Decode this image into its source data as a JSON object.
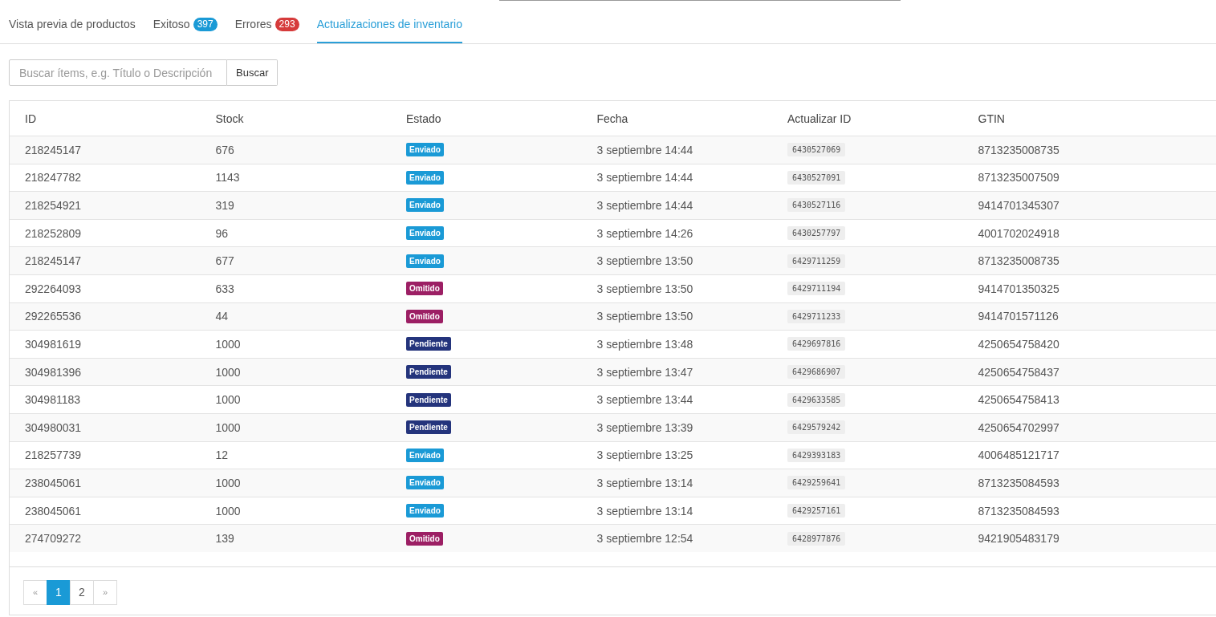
{
  "tabs": [
    {
      "label": "Vista previa de productos",
      "selected": false
    },
    {
      "label": "Exitoso",
      "count": {
        "text": "397",
        "color": "#1a9ad6"
      },
      "selected": false
    },
    {
      "label": "Errores",
      "count": {
        "text": "293",
        "color": "#d63b3b"
      },
      "selected": false
    },
    {
      "label": "Actualizaciones de inventario",
      "selected": true
    }
  ],
  "search": {
    "placeholder": "Buscar ítems, e.g. Título o Descripción",
    "button": "Buscar"
  },
  "table": {
    "columns": [
      "ID",
      "Stock",
      "Estado",
      "Fecha",
      "Actualizar ID",
      "GTIN"
    ],
    "rows": [
      {
        "id": "218245147",
        "stock": "676",
        "status": "Enviado",
        "color": "#1a9ad6",
        "date": "3 septiembre 14:44",
        "update_id": "6430527069",
        "gtin": "8713235008735"
      },
      {
        "id": "218247782",
        "stock": "1143",
        "status": "Enviado",
        "color": "#1a9ad6",
        "date": "3 septiembre 14:44",
        "update_id": "6430527091",
        "gtin": "8713235007509"
      },
      {
        "id": "218254921",
        "stock": "319",
        "status": "Enviado",
        "color": "#1a9ad6",
        "date": "3 septiembre 14:44",
        "update_id": "6430527116",
        "gtin": "9414701345307"
      },
      {
        "id": "218252809",
        "stock": "96",
        "status": "Enviado",
        "color": "#1a9ad6",
        "date": "3 septiembre 14:26",
        "update_id": "6430257797",
        "gtin": "4001702024918"
      },
      {
        "id": "218245147",
        "stock": "677",
        "status": "Enviado",
        "color": "#1a9ad6",
        "date": "3 septiembre 13:50",
        "update_id": "6429711259",
        "gtin": "8713235008735"
      },
      {
        "id": "292264093",
        "stock": "633",
        "status": "Omitido",
        "color": "#9c1f64",
        "date": "3 septiembre 13:50",
        "update_id": "6429711194",
        "gtin": "9414701350325"
      },
      {
        "id": "292265536",
        "stock": "44",
        "status": "Omitido",
        "color": "#9c1f64",
        "date": "3 septiembre 13:50",
        "update_id": "6429711233",
        "gtin": "9414701571126"
      },
      {
        "id": "304981619",
        "stock": "1000",
        "status": "Pendiente",
        "color": "#24347c",
        "date": "3 septiembre 13:48",
        "update_id": "6429697816",
        "gtin": "4250654758420"
      },
      {
        "id": "304981396",
        "stock": "1000",
        "status": "Pendiente",
        "color": "#24347c",
        "date": "3 septiembre 13:47",
        "update_id": "6429686907",
        "gtin": "4250654758437"
      },
      {
        "id": "304981183",
        "stock": "1000",
        "status": "Pendiente",
        "color": "#24347c",
        "date": "3 septiembre 13:44",
        "update_id": "6429633585",
        "gtin": "4250654758413"
      },
      {
        "id": "304980031",
        "stock": "1000",
        "status": "Pendiente",
        "color": "#24347c",
        "date": "3 septiembre 13:39",
        "update_id": "6429579242",
        "gtin": "4250654702997"
      },
      {
        "id": "218257739",
        "stock": "12",
        "status": "Enviado",
        "color": "#1a9ad6",
        "date": "3 septiembre 13:25",
        "update_id": "6429393183",
        "gtin": "4006485121717"
      },
      {
        "id": "238045061",
        "stock": "1000",
        "status": "Enviado",
        "color": "#1a9ad6",
        "date": "3 septiembre 13:14",
        "update_id": "6429259641",
        "gtin": "8713235084593"
      },
      {
        "id": "238045061",
        "stock": "1000",
        "status": "Enviado",
        "color": "#1a9ad6",
        "date": "3 septiembre 13:14",
        "update_id": "6429257161",
        "gtin": "8713235084593"
      },
      {
        "id": "274709272",
        "stock": "139",
        "status": "Omitido",
        "color": "#9c1f64",
        "date": "3 septiembre 12:54",
        "update_id": "6428977876",
        "gtin": "9421905483179"
      }
    ]
  },
  "pagination": [
    {
      "label": "«",
      "kind": "prev",
      "selected": false
    },
    {
      "label": "1",
      "kind": "page",
      "selected": true
    },
    {
      "label": "2",
      "kind": "page",
      "selected": false
    },
    {
      "label": "»",
      "kind": "next",
      "selected": false
    }
  ]
}
